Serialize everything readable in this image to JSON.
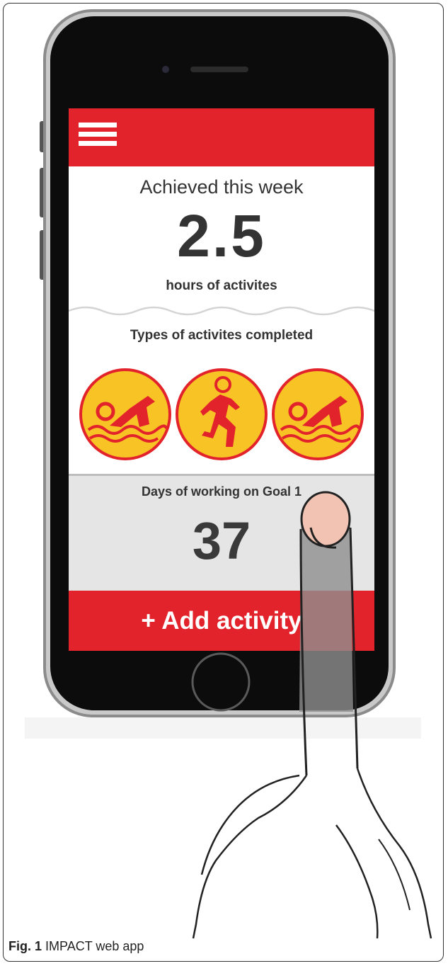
{
  "figure": {
    "label": "Fig. 1",
    "caption": "IMPACT web app"
  },
  "app": {
    "menu_icon": "hamburger-menu-icon",
    "achieved": {
      "title": "Achieved this week",
      "value": "2.5",
      "unit": "hours of activites"
    },
    "types": {
      "title": "Types of activites completed",
      "icons": [
        "swimming-icon",
        "running-icon",
        "swimming-icon"
      ]
    },
    "goal": {
      "title": "Days of working on Goal 1",
      "value": "37"
    },
    "add_button_label": "+ Add activity"
  },
  "colors": {
    "accent_red": "#e3232b",
    "icon_yellow": "#f7c325",
    "panel_gray": "#e5e5e5"
  }
}
